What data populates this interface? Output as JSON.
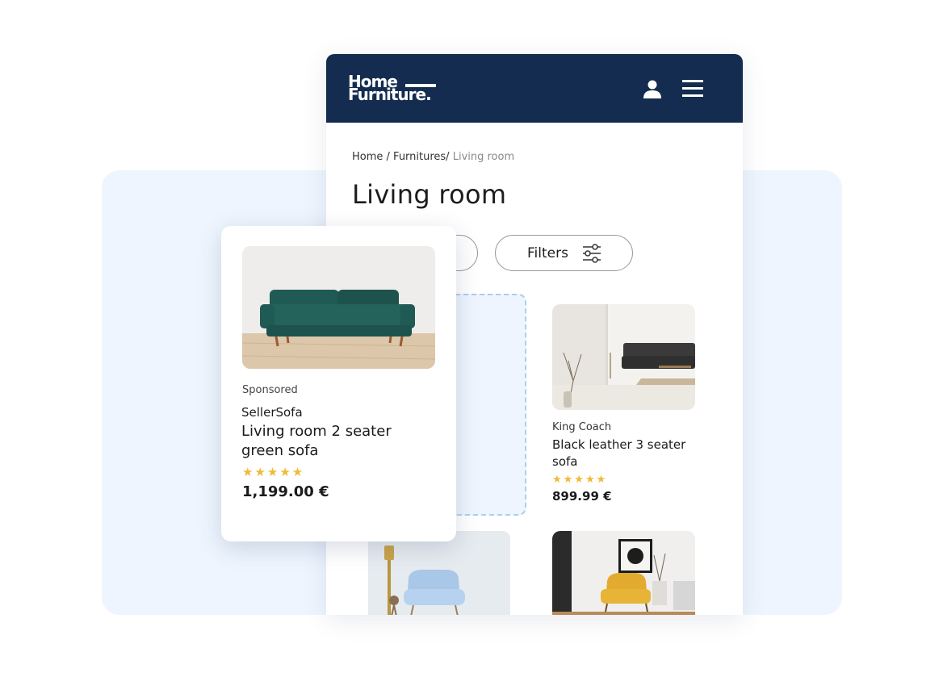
{
  "app": {
    "logo_line1": "Home",
    "logo_line2": "Furniture.",
    "brand_color": "#132c4f",
    "icons": [
      "user-icon",
      "hamburger-menu-icon",
      "filter-sliders-icon",
      "star-icon"
    ]
  },
  "breadcrumb": {
    "home": "Home",
    "sep1": " / ",
    "category": "Furnitures/",
    "current": " Living room"
  },
  "page": {
    "title": "Living room"
  },
  "toolbar": {
    "filters_label": "Filters"
  },
  "sponsored": {
    "label": "Sponsored",
    "brand": "SellerSofa",
    "title": "Living room 2 seater green sofa",
    "stars": "★★★★★",
    "price": "1,199.00 €"
  },
  "products": [
    {
      "brand": "King Coach",
      "title": "Black leather 3 seater sofa",
      "stars": "★★★★★",
      "price": "899.99 €"
    }
  ],
  "colors": {
    "accent_star": "#f1b935",
    "dashed_outline": "#a9cff2",
    "panel_bg": "#eef5fe"
  }
}
